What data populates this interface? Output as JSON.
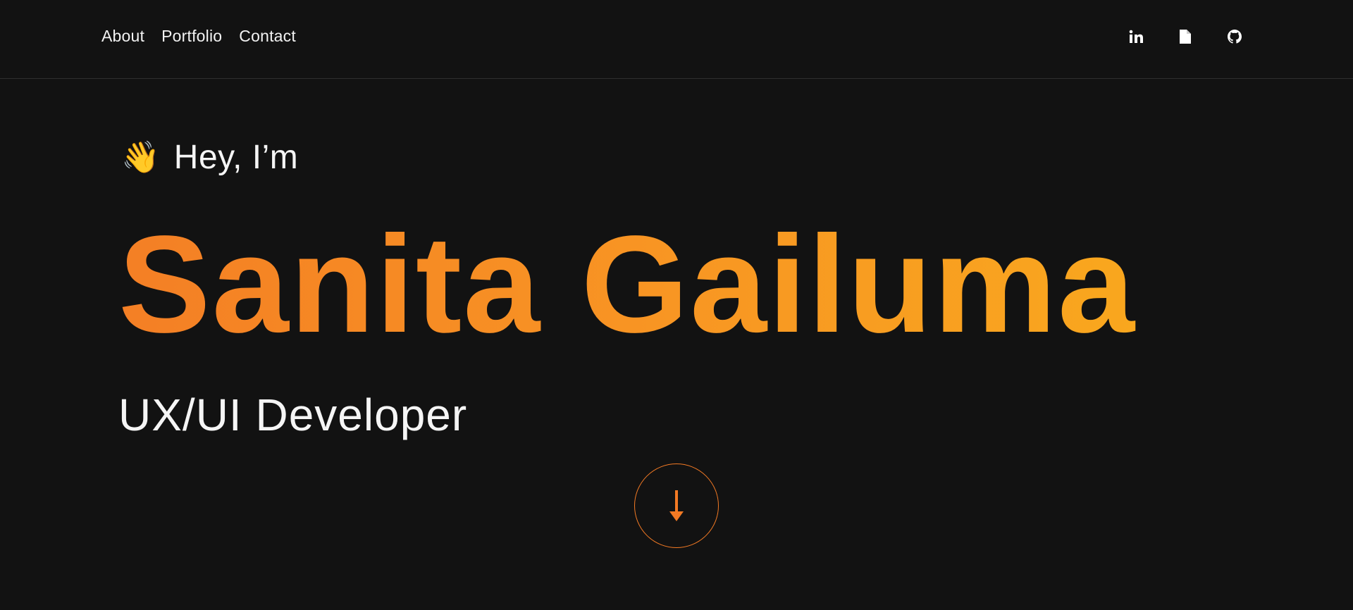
{
  "nav": {
    "links": [
      {
        "label": "About"
      },
      {
        "label": "Portfolio"
      },
      {
        "label": "Contact"
      }
    ],
    "icons": [
      {
        "name": "linkedin-icon",
        "glyph": "in"
      },
      {
        "name": "document-icon"
      },
      {
        "name": "github-icon"
      }
    ]
  },
  "hero": {
    "greeting_emoji": "👋",
    "greeting": "Hey, I’m",
    "name": "Sanita Gailuma",
    "role": "UX/UI Developer"
  },
  "colors": {
    "background": "#121212",
    "accent_start": "#f47f25",
    "accent_end": "#f9a71e",
    "text": "#ffffff"
  }
}
